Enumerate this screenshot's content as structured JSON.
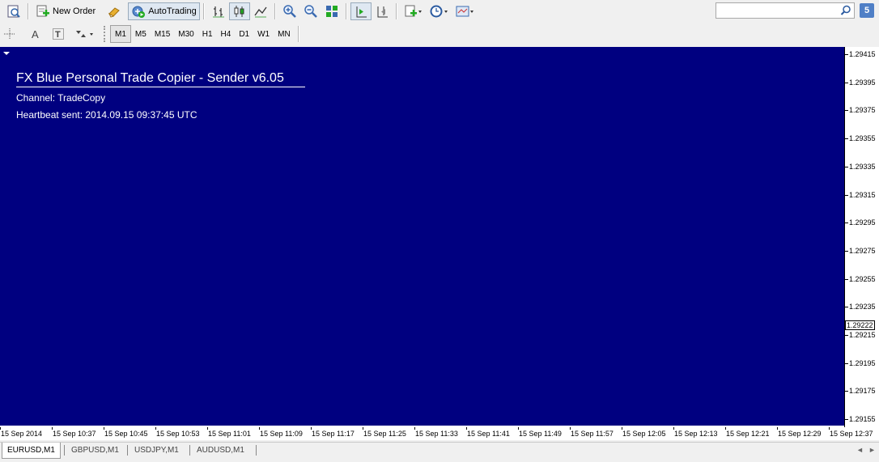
{
  "toolbar": {
    "new_order_label": "New Order",
    "autotrading_label": "AutoTrading",
    "timeframes": [
      "M1",
      "M5",
      "M15",
      "M30",
      "H1",
      "H4",
      "D1",
      "W1",
      "MN"
    ],
    "active_timeframe": "M1",
    "search_placeholder": "",
    "help_label": "5"
  },
  "chart": {
    "background_color": "#000080",
    "info": {
      "title": "FX Blue Personal Trade Copier - Sender v6.05",
      "channel": "Channel: TradeCopy",
      "heartbeat": "Heartbeat sent: 2014.09.15 09:37:45 UTC"
    },
    "price_labels": [
      "1.29415",
      "1.29395",
      "1.29375",
      "1.29355",
      "1.29335",
      "1.29315",
      "1.29295",
      "1.29275",
      "1.29255",
      "1.29235",
      "1.29215",
      "1.29195",
      "1.29175",
      "1.29155"
    ],
    "current_price": "1.29222",
    "time_labels": [
      "15 Sep 2014",
      "15 Sep 10:37",
      "15 Sep 10:45",
      "15 Sep 10:53",
      "15 Sep 11:01",
      "15 Sep 11:09",
      "15 Sep 11:17",
      "15 Sep 11:25",
      "15 Sep 11:33",
      "15 Sep 11:41",
      "15 Sep 11:49",
      "15 Sep 11:57",
      "15 Sep 12:05",
      "15 Sep 12:13",
      "15 Sep 12:21",
      "15 Sep 12:29",
      "15 Sep 12:37"
    ]
  },
  "tabs": [
    {
      "label": "EURUSD,M1",
      "active": true
    },
    {
      "label": "GBPUSD,M1",
      "active": false
    },
    {
      "label": "USDJPY,M1",
      "active": false
    },
    {
      "label": "AUDUSD,M1",
      "active": false
    }
  ]
}
